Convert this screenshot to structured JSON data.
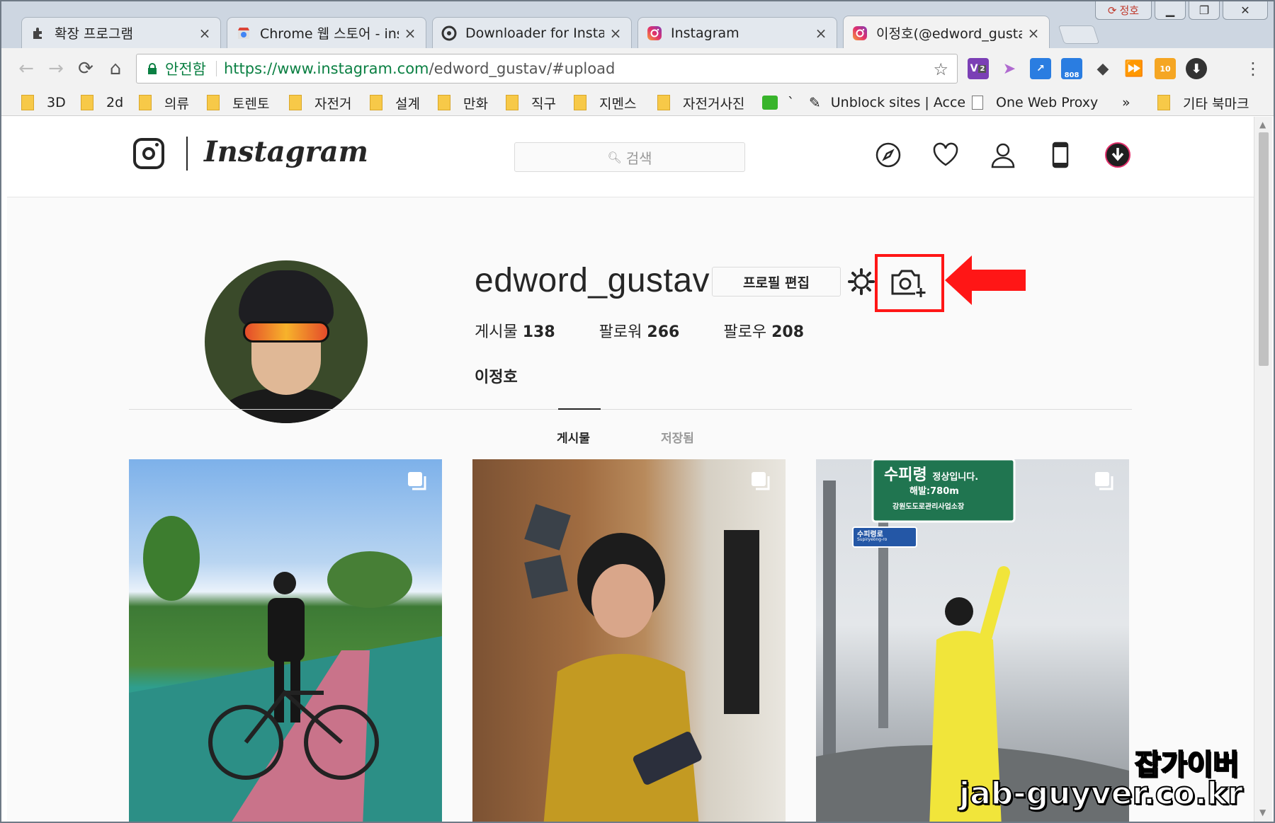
{
  "window": {
    "controls": {
      "profile": "정호",
      "minimize": "▁",
      "restore": "❐",
      "close": "✕"
    }
  },
  "tabs": [
    {
      "title": "확장 프로그램",
      "icon": "puzzle-icon"
    },
    {
      "title": "Chrome 웹 스토어 - inst",
      "icon": "chrome-store-icon"
    },
    {
      "title": "Downloader for Instagra",
      "icon": "downloader-icon"
    },
    {
      "title": "Instagram",
      "icon": "instagram-icon"
    },
    {
      "title": "이정호(@edword_gustav",
      "icon": "instagram-icon"
    }
  ],
  "toolbar": {
    "secure_label": "안전함",
    "url_prefix": "https://www.instagram.com",
    "url_path": "/edword_gustav/#upload",
    "extensions": [
      {
        "name": "vimium-ext-icon",
        "color": "#7b3fb5",
        "badge": "2"
      },
      {
        "name": "cursor-ext-icon",
        "color": "#b06ad0"
      },
      {
        "name": "chart-ext-icon",
        "color": "#2a7de1"
      },
      {
        "name": "counter-ext-icon",
        "color": "#2a7de1",
        "badge": "808"
      },
      {
        "name": "eraser-ext-icon",
        "color": "#444444"
      },
      {
        "name": "forward-ext-icon",
        "color": "#444444"
      },
      {
        "name": "lion-ext-icon",
        "color": "#f5a623"
      },
      {
        "name": "download-ext-icon",
        "color": "#333333"
      }
    ]
  },
  "bookmarks": {
    "items": [
      "3D",
      "2d",
      "의류",
      "토렌토",
      "자전거",
      "설계",
      "만화",
      "직구",
      "지멘스",
      "자전거사진",
      "`",
      "Unblock sites | Acce",
      "One Web Proxy"
    ],
    "overflow": "»",
    "other": "기타 북마크"
  },
  "ig": {
    "wordmark": "Instagram",
    "search_placeholder": "검색",
    "profile": {
      "username": "edword_gustav",
      "edit_label": "프로필 편집",
      "posts_label": "게시물",
      "posts_count": "138",
      "followers_label": "팔로워",
      "followers_count": "266",
      "following_label": "팔로우",
      "following_count": "208",
      "full_name": "이정호"
    },
    "tabs": {
      "posts": "게시물",
      "saved": "저장됨"
    },
    "post3_sign": {
      "title": "수피령",
      "subtitle": "정상입니다.",
      "altitude": "해발:780m",
      "authority": "강원도도로관리사업소장",
      "small_sign": "수피령로",
      "small_sign_en": "Supiryeong-ro"
    }
  },
  "watermark": {
    "line1": "잡가이버",
    "line2": "jab-guyver.co.kr"
  },
  "colors": {
    "highlight": "#ff1616",
    "secure_green": "#0b8043",
    "ig_text": "#262626"
  }
}
